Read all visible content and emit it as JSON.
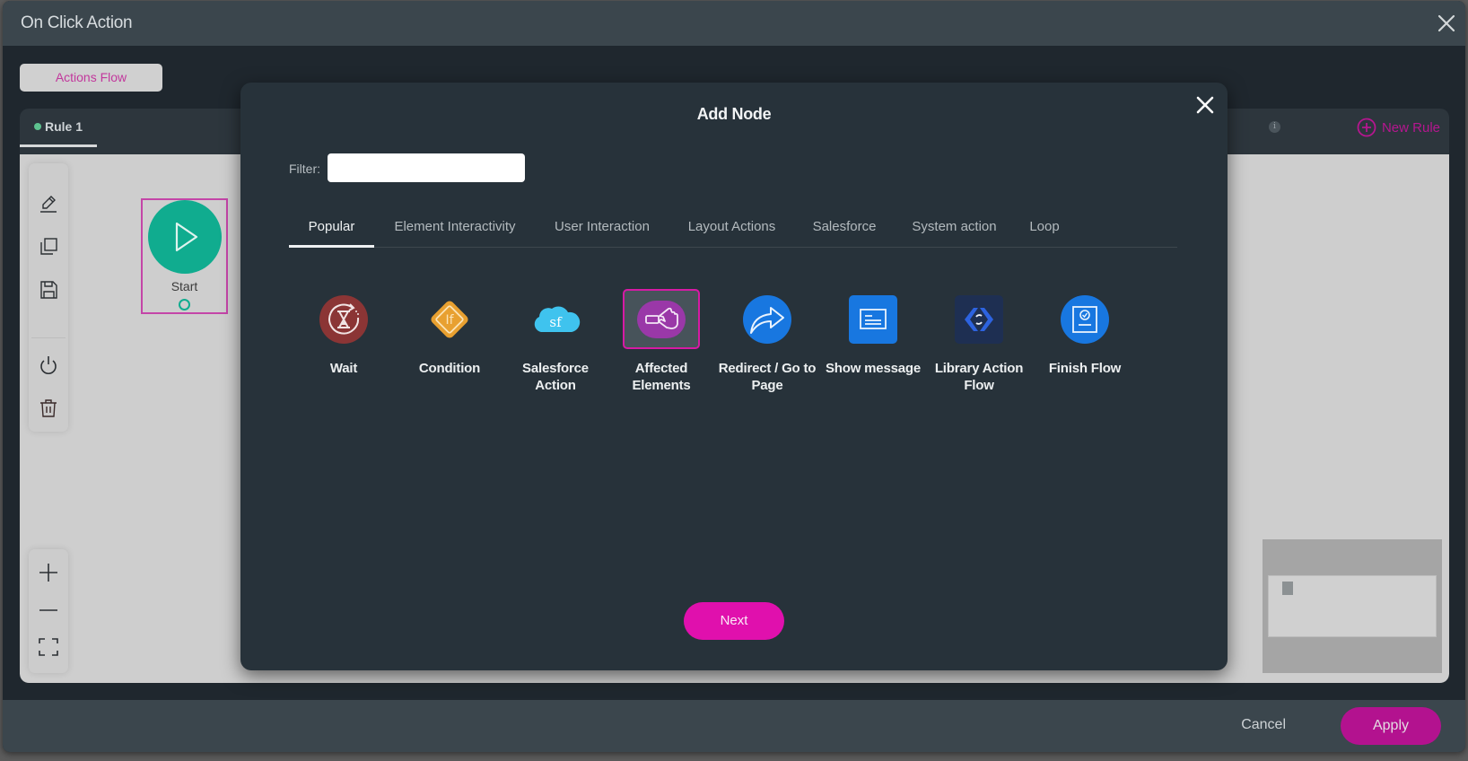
{
  "window": {
    "title": "On Click Action",
    "close_icon": "close-icon"
  },
  "actions_flow_button": "Actions Flow",
  "rule_panel": {
    "rule_tab_label": "Rule 1",
    "rule_status_color": "#5dc28f",
    "info_icon": "i",
    "new_rule_label": "New Rule"
  },
  "toolbar": {
    "tools": [
      "edit-icon",
      "copy-icon",
      "save-icon",
      "power-icon",
      "trash-icon"
    ],
    "zoom_tools": [
      "zoom-in-icon",
      "zoom-out-icon",
      "fit-screen-icon"
    ]
  },
  "canvas": {
    "start_node_label": "Start"
  },
  "footer": {
    "cancel_label": "Cancel",
    "apply_label": "Apply"
  },
  "modal": {
    "title": "Add Node",
    "filter_label": "Filter:",
    "filter_value": "",
    "tabs": [
      {
        "label": "Popular",
        "active": true
      },
      {
        "label": "Element Interactivity",
        "active": false
      },
      {
        "label": "User Interaction",
        "active": false
      },
      {
        "label": "Layout Actions",
        "active": false
      },
      {
        "label": "Salesforce",
        "active": false
      },
      {
        "label": "System action",
        "active": false
      },
      {
        "label": "Loop",
        "active": false
      }
    ],
    "nodes": [
      {
        "label": "Wait",
        "icon": "hourglass-icon",
        "color": "#8b3535",
        "selected": false
      },
      {
        "label": "Condition",
        "icon": "if-diamond-icon",
        "color": "#e8a030",
        "selected": false
      },
      {
        "label": "Salesforce Action",
        "icon": "salesforce-cloud-icon",
        "color": "#3fc3ee",
        "selected": false
      },
      {
        "label": "Affected Elements",
        "icon": "hand-pointer-icon",
        "color": "#9a38a8",
        "selected": true
      },
      {
        "label": "Redirect / Go to Page",
        "icon": "redirect-arrow-icon",
        "color": "#1877e0",
        "selected": false
      },
      {
        "label": "Show message",
        "icon": "message-icon",
        "color": "#1877e0",
        "selected": false
      },
      {
        "label": "Library Action Flow",
        "icon": "library-flow-icon",
        "color": "#1e2f52",
        "selected": false
      },
      {
        "label": "Finish Flow",
        "icon": "finish-flow-icon",
        "color": "#1877e0",
        "selected": false
      }
    ],
    "next_label": "Next"
  },
  "colors": {
    "accent": "#b3128f",
    "accent_bright": "#e010ad",
    "start_node": "#10ac8f"
  }
}
